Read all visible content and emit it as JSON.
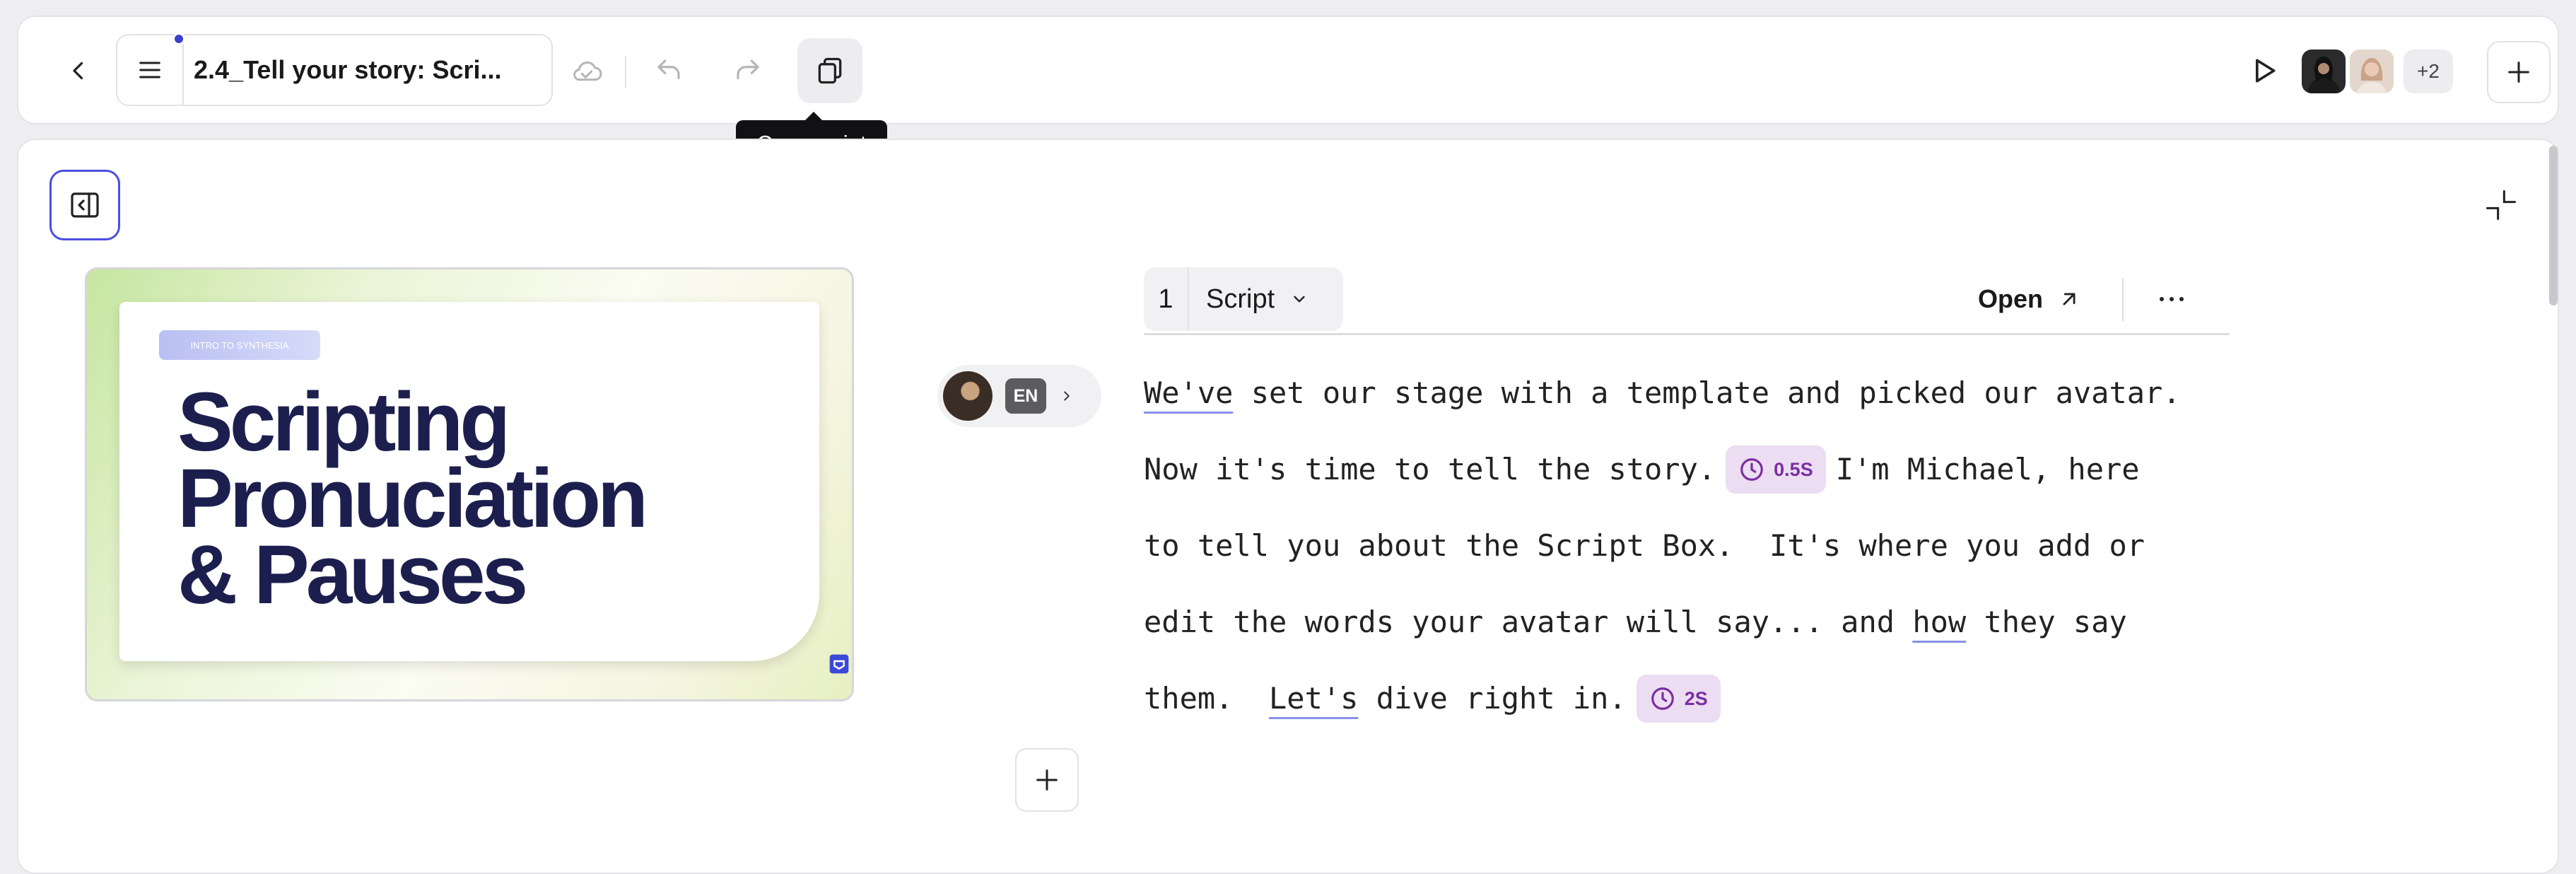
{
  "toolbar": {
    "title": "2.4_Tell your story: Scri...",
    "extra_collaborators": "+2",
    "copy_tooltip": "Copy script"
  },
  "slide": {
    "badge": "INTRO TO SYNTHESIA",
    "title_line1": "Scripting",
    "title_line2": "Pronuciation",
    "title_line3": "& Pauses"
  },
  "voice": {
    "language": "EN"
  },
  "scene": {
    "number": "1",
    "type": "Script",
    "open_label": "Open"
  },
  "script": {
    "line1": {
      "first_word": "We've",
      "rest": " set our stage with a template and picked our avatar."
    },
    "line2": {
      "before": "Now it's time to tell the story.",
      "pause": "0.5S",
      "after": "I'm Michael, here"
    },
    "line3": "to tell you about the Script Box.  It's where you add or",
    "line4": {
      "before": "edit the words your avatar will say... and ",
      "word": "how",
      "after": " they say"
    },
    "line5": {
      "before": "them.  ",
      "word": "Let's",
      "after": " dive right in.",
      "pause": "2S"
    }
  },
  "colors": {
    "accent": "#4A4FE0",
    "pause_bg": "#ECDDF2",
    "pause_text": "#7A2FA0",
    "slide_title": "#1C1F4E"
  }
}
